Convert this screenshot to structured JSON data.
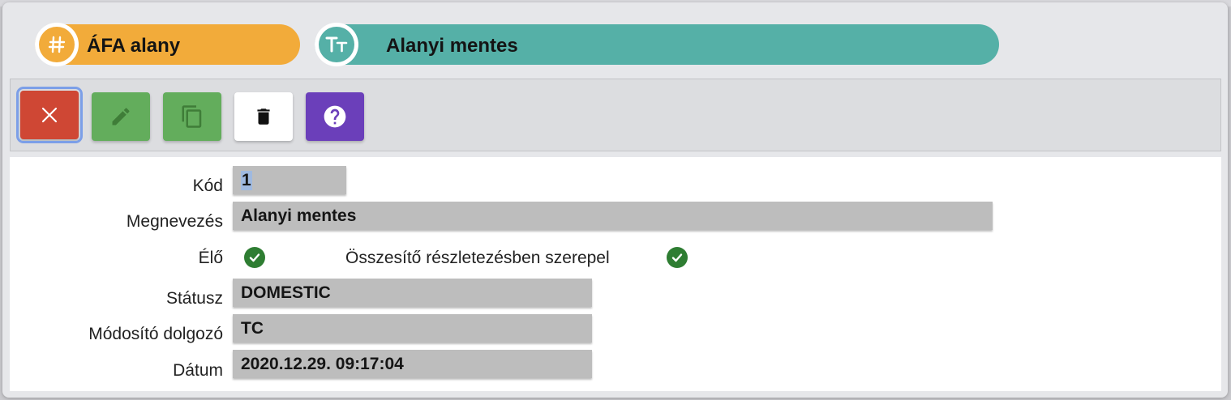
{
  "header": {
    "code_pill": {
      "icon": "hash-icon",
      "label": "ÁFA alany",
      "color": "#f2ab3a"
    },
    "name_pill": {
      "icon": "text-type-icon",
      "label": "Alanyi mentes",
      "color": "#55b0a7"
    }
  },
  "toolbar": {
    "buttons": [
      {
        "name": "close",
        "icon": "close-icon",
        "color": "#cf4734"
      },
      {
        "name": "edit",
        "icon": "pencil-icon",
        "color": "#63ad5c"
      },
      {
        "name": "copy",
        "icon": "copy-icon",
        "color": "#63ad5c"
      },
      {
        "name": "delete",
        "icon": "trash-icon",
        "color": "#ffffff"
      },
      {
        "name": "help",
        "icon": "help-icon",
        "color": "#6b3fba"
      }
    ]
  },
  "form": {
    "kod": {
      "label": "Kód",
      "value": "1"
    },
    "megnevezes": {
      "label": "Megnevezés",
      "value": "Alanyi mentes"
    },
    "elo": {
      "label": "Élő",
      "checked": true
    },
    "osszesito": {
      "label": "Összesítő részletezésben szerepel",
      "checked": true
    },
    "statusz": {
      "label": "Státusz",
      "value": "DOMESTIC"
    },
    "modosito": {
      "label": "Módosító dolgozó",
      "value": "TC"
    },
    "datum": {
      "label": "Dátum",
      "value": "2020.12.29. 09:17:04"
    }
  }
}
